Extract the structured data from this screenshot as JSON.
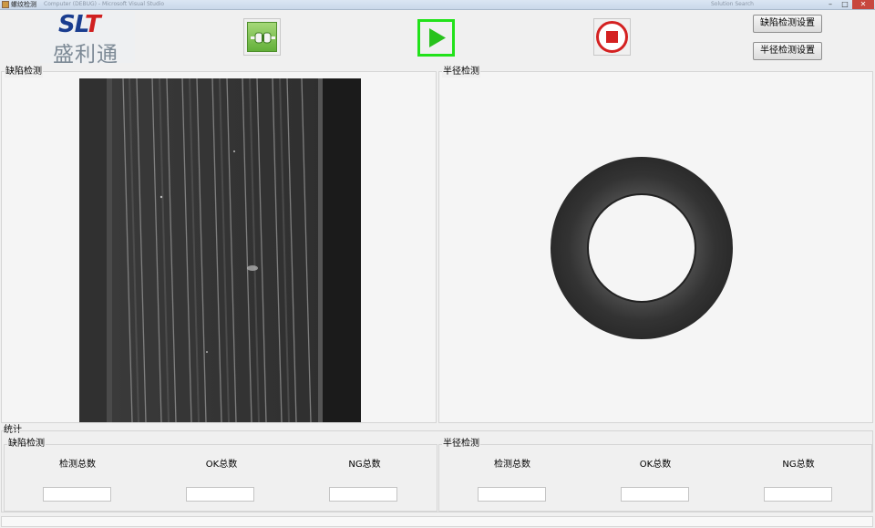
{
  "window": {
    "title": "螺纹检测",
    "ghost_title": "Computer (DEBUG) - Microsoft Visual Studio",
    "ghost_right": "Solution Search",
    "min_glyph": "–",
    "max_glyph": "□",
    "close_glyph": "✕"
  },
  "logo": {
    "brand_latin_a": "SL",
    "brand_latin_b": "T",
    "brand_cn": "盛利通"
  },
  "toolbar": {
    "connect_icon": "connect-icon",
    "start_icon": "play-icon",
    "stop_icon": "stop-icon",
    "defect_settings_label": "缺陷检测设置",
    "radius_settings_label": "半径检测设置",
    "colors": {
      "start_border": "#22e21a",
      "stop_ring": "#d42121",
      "play_fill": "#27c21c"
    }
  },
  "defect_panel": {
    "title": "缺陷检测"
  },
  "radius_panel": {
    "title": "半径检测"
  },
  "stats": {
    "title": "统计",
    "defect_group": {
      "title": "缺陷检测",
      "total_label": "检测总数",
      "ok_label": "OK总数",
      "ng_label": "NG总数",
      "total_value": "",
      "ok_value": "",
      "ng_value": ""
    },
    "radius_group": {
      "title": "半径检测",
      "total_label": "检测总数",
      "ok_label": "OK总数",
      "ng_label": "NG总数",
      "total_value": "",
      "ok_value": "",
      "ng_value": ""
    }
  }
}
